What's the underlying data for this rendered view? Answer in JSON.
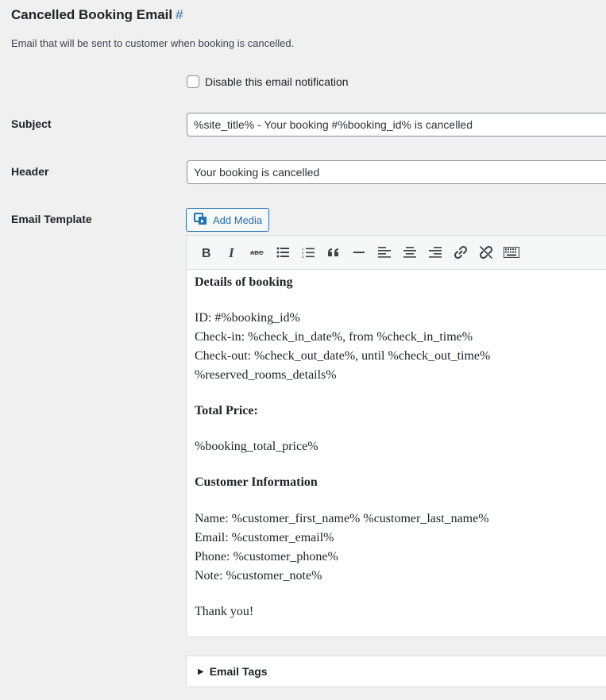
{
  "section": {
    "title": "Cancelled Booking Email",
    "anchor": "#",
    "description": "Email that will be sent to customer when booking is cancelled."
  },
  "disable_notification": {
    "label": "Disable this email notification",
    "checked": false
  },
  "subject": {
    "label": "Subject",
    "value": "%site_title% - Your booking #%booking_id% is cancelled"
  },
  "header": {
    "label": "Header",
    "value": "Your booking is cancelled"
  },
  "template": {
    "label": "Email Template",
    "add_media_label": "Add Media",
    "toolbar": [
      {
        "name": "bold-button",
        "glyph": "B"
      },
      {
        "name": "italic-button",
        "glyph": "I"
      },
      {
        "name": "strikethrough-button",
        "glyph": "ABC"
      },
      {
        "name": "bullet-list-button",
        "glyph": "ul"
      },
      {
        "name": "numbered-list-button",
        "glyph": "ol"
      },
      {
        "name": "blockquote-button",
        "glyph": "“"
      },
      {
        "name": "horizontal-line-button",
        "glyph": "—"
      },
      {
        "name": "align-left-button",
        "glyph": "al"
      },
      {
        "name": "align-center-button",
        "glyph": "ac"
      },
      {
        "name": "align-right-button",
        "glyph": "ar"
      },
      {
        "name": "insert-link-button",
        "glyph": "link"
      },
      {
        "name": "remove-link-button",
        "glyph": "unlink"
      },
      {
        "name": "toolbar-toggle-button",
        "glyph": "kbd"
      }
    ],
    "content": {
      "details_heading": "Details of booking",
      "id_line": "ID: #%booking_id%",
      "checkin_line": "Check-in: %check_in_date%, from %check_in_time%",
      "checkout_line": "Check-out: %check_out_date%, until %check_out_time%",
      "rooms_line": "%reserved_rooms_details%",
      "total_heading": "Total Price:",
      "total_line": "%booking_total_price%",
      "customer_heading": "Customer Information",
      "name_line": "Name: %customer_first_name% %customer_last_name%",
      "email_line": "Email: %customer_email%",
      "phone_line": "Phone: %customer_phone%",
      "note_line": "Note: %customer_note%",
      "thanks_line": "Thank you!"
    }
  },
  "email_tags": {
    "label": "Email Tags"
  },
  "colors": {
    "accent": "#2271b1",
    "background": "#f0f0f1",
    "border": "#8c8f94"
  }
}
